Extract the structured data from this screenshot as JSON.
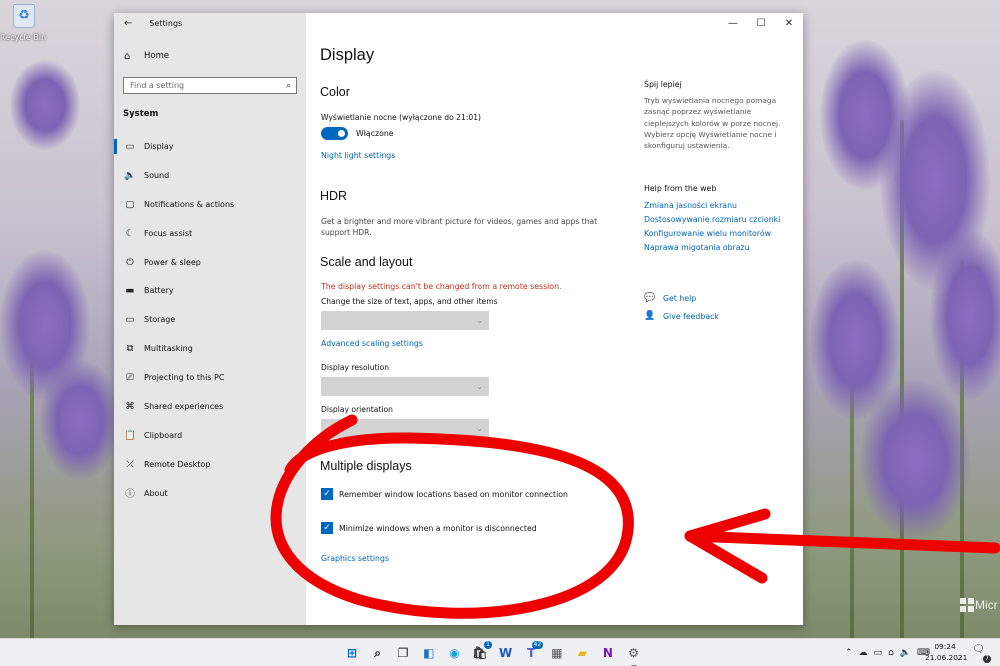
{
  "desktop": {
    "recycle_bin_label": "Recycle Bin",
    "watermark_text": "Micr"
  },
  "window": {
    "app_title": "Settings",
    "home_label": "Home",
    "search_placeholder": "Find a setting",
    "category_header": "System",
    "nav_items": [
      {
        "label": "Display",
        "icon": "monitor-icon",
        "active": true
      },
      {
        "label": "Sound",
        "icon": "speaker-icon"
      },
      {
        "label": "Notifications & actions",
        "icon": "notification-icon"
      },
      {
        "label": "Focus assist",
        "icon": "moon-icon"
      },
      {
        "label": "Power & sleep",
        "icon": "power-icon"
      },
      {
        "label": "Battery",
        "icon": "battery-icon"
      },
      {
        "label": "Storage",
        "icon": "storage-icon"
      },
      {
        "label": "Multitasking",
        "icon": "multitasking-icon"
      },
      {
        "label": "Projecting to this PC",
        "icon": "projector-icon"
      },
      {
        "label": "Shared experiences",
        "icon": "shared-icon"
      },
      {
        "label": "Clipboard",
        "icon": "clipboard-icon"
      },
      {
        "label": "Remote Desktop",
        "icon": "remote-desktop-icon"
      },
      {
        "label": "About",
        "icon": "info-icon"
      }
    ]
  },
  "display": {
    "page_title": "Display",
    "color_header": "Color",
    "night_light_label": "Wyświetlanie nocne (wyłączone do 21:01)",
    "night_light_toggle_text": "Włączone",
    "night_light_on": true,
    "night_light_link": "Night light settings",
    "hdr_header": "HDR",
    "hdr_desc": "Get a brighter and more vibrant picture for videos, games and apps that support HDR.",
    "scale_header": "Scale and layout",
    "remote_warning": "The display settings can't be changed from a remote session.",
    "text_size_label": "Change the size of text, apps, and other items",
    "advanced_scaling_link": "Advanced scaling settings",
    "resolution_label": "Display resolution",
    "orientation_label": "Display orientation",
    "multiple_header": "Multiple displays",
    "remember_locations_label": "Remember window locations based on monitor connection",
    "minimize_windows_label": "Minimize windows when a monitor is disconnected",
    "remember_locations_checked": true,
    "minimize_windows_checked": true,
    "graphics_link": "Graphics settings"
  },
  "right_panel": {
    "sleep_header": "Śpij lepiej",
    "sleep_desc": "Tryb wyświetlania nocnego pomaga zasnąć poprzez wyświetlanie cieplejszych kolorów w porze nocnej. Wybierz opcję Wyświetlanie nocne i skonfiguruj ustawienia.",
    "web_header": "Help from the web",
    "web_links": [
      "Zmiana jasności ekranu",
      "Dostosowywanie rozmiaru czcionki",
      "Konfigurowanie wielu monitorów",
      "Naprawa migotania obrazu"
    ],
    "get_help": "Get help",
    "give_feedback": "Give feedback"
  },
  "taskbar": {
    "apps": [
      {
        "name": "start-icon"
      },
      {
        "name": "search-icon"
      },
      {
        "name": "task-view-icon"
      },
      {
        "name": "widgets-icon"
      },
      {
        "name": "edge-icon"
      },
      {
        "name": "store-icon",
        "badge": "1"
      },
      {
        "name": "word-icon"
      },
      {
        "name": "teams-icon",
        "badge": "42"
      },
      {
        "name": "calculator-icon"
      },
      {
        "name": "file-explorer-icon"
      },
      {
        "name": "onenote-icon"
      },
      {
        "name": "settings-icon",
        "running": true
      }
    ],
    "time": "09:24",
    "date": "21.06.2021",
    "notification_count": "7"
  },
  "colors": {
    "accent": "#0067c0",
    "link": "#0063b1",
    "error": "#c42b1c",
    "annotation": "#ec0000"
  }
}
